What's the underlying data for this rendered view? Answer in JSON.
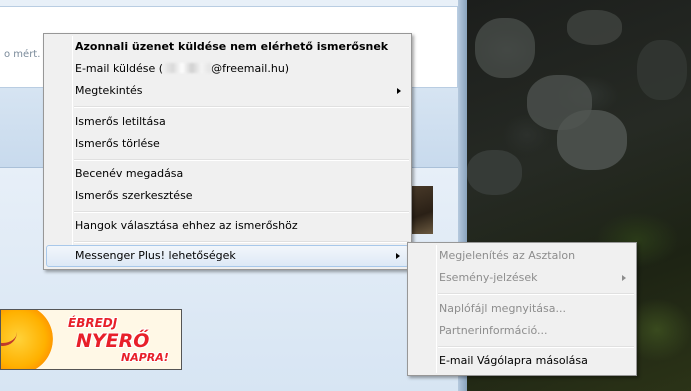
{
  "background": {
    "clipped_text": "o mért.",
    "banner": {
      "line1": "ÉBREDJ",
      "line2": "NYERŐ",
      "line3": "NAPRA!"
    }
  },
  "context_menu": {
    "items": [
      {
        "label": "Azonnali üzenet küldése nem elérhető ismerősnek",
        "bold": true
      },
      {
        "label_prefix": "E-mail küldése (",
        "label_suffix": "@freemail.hu)",
        "redacted": true
      },
      {
        "label": "Megtekintés",
        "submenu": true
      },
      {
        "label": "Ismerős letiltása"
      },
      {
        "label": "Ismerős törlése"
      },
      {
        "label": "Becenév megadása"
      },
      {
        "label": "Ismerős szerkesztése"
      },
      {
        "label": "Hangok választása ehhez az ismerőshöz"
      },
      {
        "label": "Messenger Plus! lehetőségek",
        "submenu": true,
        "highlighted": true
      }
    ]
  },
  "submenu": {
    "items": [
      {
        "label": "Megjelenítés az Asztalon",
        "disabled": true
      },
      {
        "label": "Esemény-jelzések",
        "disabled": true,
        "submenu": true
      },
      {
        "label": "Naplófájl megnyitása...",
        "disabled": true
      },
      {
        "label": "Partnerinformáció...",
        "disabled": true
      },
      {
        "label": "E-mail Vágólapra másolása",
        "disabled": false
      }
    ]
  },
  "colors": {
    "menu_bg": "#f0f0f0",
    "menu_border": "#979797",
    "highlight_border": "#a8c8ea",
    "disabled_text": "#8d8d8d",
    "banner_text": "#e8202a"
  }
}
